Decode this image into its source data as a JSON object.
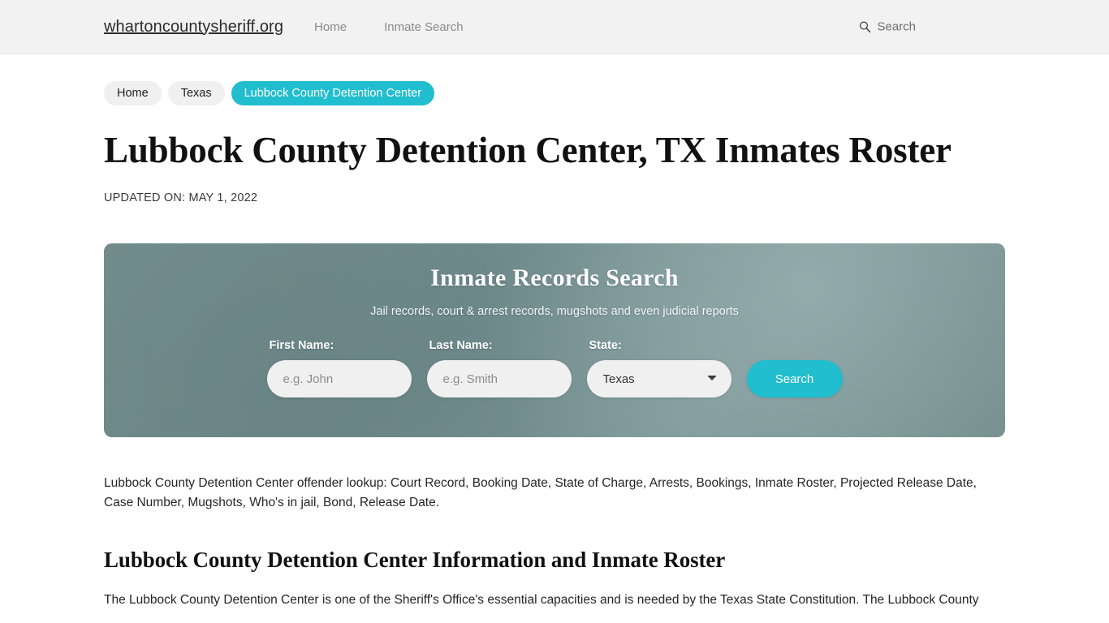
{
  "header": {
    "brand": "whartoncountysheriff.org",
    "nav": [
      {
        "label": "Home"
      },
      {
        "label": "Inmate Search"
      }
    ],
    "search": {
      "icon": "search-icon",
      "label": "Search"
    }
  },
  "breadcrumb": [
    {
      "label": "Home",
      "active": false
    },
    {
      "label": "Texas",
      "active": false
    },
    {
      "label": "Lubbock County Detention Center",
      "active": true
    }
  ],
  "article": {
    "title": "Lubbock County Detention Center, TX Inmates Roster",
    "updated": "UPDATED ON: MAY 1, 2022",
    "lede": "Lubbock County Detention Center offender lookup: Court Record, Booking Date, State of Charge, Arrests, Bookings, Inmate Roster, Projected Release Date, Case Number, Mugshots, Who's in jail, Bond, Release Date.",
    "section_heading": "Lubbock County Detention Center Information and Inmate Roster",
    "body_copy": "The Lubbock County Detention Center is one of the Sheriff's Office's essential capacities and is needed by the Texas State Constitution. The Lubbock County"
  },
  "hero": {
    "title": "Inmate Records Search",
    "subtitle": "Jail records, court & arrest records, mugshots and even judicial reports",
    "first_name": {
      "label": "First Name:",
      "placeholder": "e.g. John",
      "value": ""
    },
    "last_name": {
      "label": "Last Name:",
      "placeholder": "e.g. Smith",
      "value": ""
    },
    "state": {
      "label": "State:",
      "selected": "Texas"
    },
    "submit_label": "Search"
  },
  "colors": {
    "accent_teal": "#20bece",
    "header_bg": "#f2f2f2",
    "hero_bg": "#74908f",
    "pill_bg": "#f0f0f0"
  }
}
